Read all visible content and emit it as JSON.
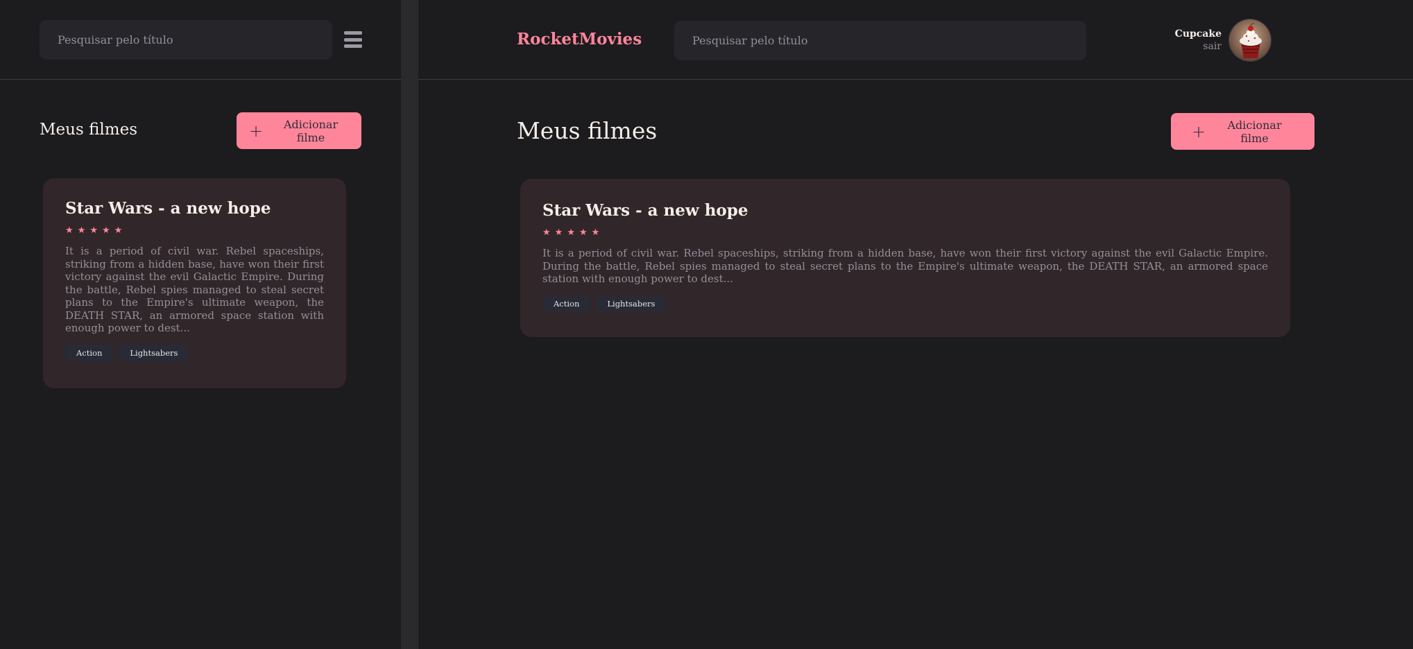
{
  "mobile": {
    "search": {
      "placeholder": "Pesquisar pelo título"
    },
    "menu_icon": "hamburger-menu-icon",
    "section_title": "Meus filmes",
    "add_button": {
      "icon": "plus-icon",
      "label": "Adicionar filme"
    },
    "movies": [
      {
        "title": "Star Wars - a new hope",
        "rating": 5,
        "rating_max": 5,
        "description": "It is a period of civil war. Rebel spaceships, striking from a hidden base, have won their first victory against the evil Galactic Empire. During the battle, Rebel spies managed to steal secret plans to the Empire's ultimate weapon, the DEATH STAR, an armored space station with enough power to dest...",
        "tags": [
          "Action",
          "Lightsabers"
        ]
      }
    ]
  },
  "desktop": {
    "brand": "RocketMovies",
    "search": {
      "placeholder": "Pesquisar pelo título"
    },
    "profile": {
      "name": "Cupcake",
      "logout": "sair",
      "avatar": "cupcake-avatar"
    },
    "section_title": "Meus filmes",
    "add_button": {
      "icon": "plus-icon",
      "label": "Adicionar filme"
    },
    "movies": [
      {
        "title": "Star Wars - a new hope",
        "rating": 5,
        "rating_max": 5,
        "description": "It is a period of civil war. Rebel spaceships, striking from a hidden base, have won their first victory against the evil Galactic Empire. During the battle, Rebel spies managed to steal secret plans to the Empire's ultimate weapon, the DEATH STAR, an armored space station with enough power to dest...",
        "tags": [
          "Action",
          "Lightsabers"
        ]
      }
    ]
  },
  "colors": {
    "accent": "#ff859b",
    "background": "#1c1b1e",
    "card": "#312629",
    "input": "#262529",
    "muted_text": "#948f99",
    "tag_bg": "#282a36"
  }
}
